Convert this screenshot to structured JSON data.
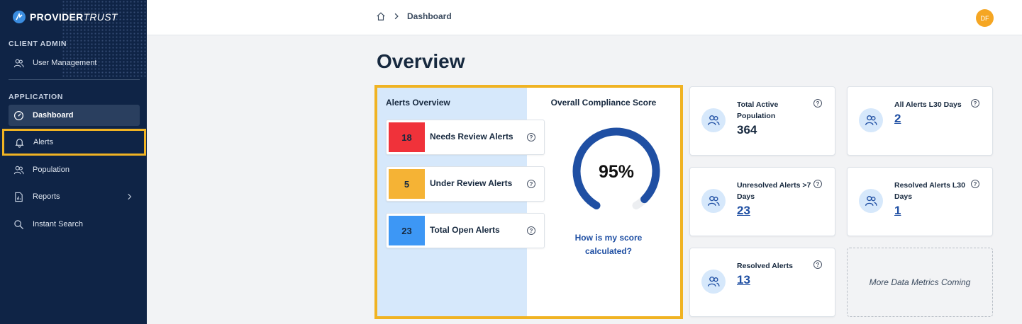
{
  "brand": {
    "name_bold": "PROVIDER",
    "name_light": "TRUST"
  },
  "sidebar": {
    "client_admin_label": "CLIENT ADMIN",
    "user_management": "User Management",
    "application_label": "APPLICATION",
    "items": [
      {
        "label": "Dashboard",
        "icon": "dashboard-icon"
      },
      {
        "label": "Alerts",
        "icon": "bell-icon"
      },
      {
        "label": "Population",
        "icon": "users-icon"
      },
      {
        "label": "Reports",
        "icon": "report-icon"
      },
      {
        "label": "Instant Search",
        "icon": "search-icon"
      }
    ]
  },
  "topbar": {
    "breadcrumb_current": "Dashboard",
    "avatar_initials": "DF"
  },
  "page": {
    "title": "Overview"
  },
  "alerts_overview": {
    "title": "Alerts Overview",
    "alerts": [
      {
        "count": "18",
        "label": "Needs Review Alerts",
        "color": "#f0323a"
      },
      {
        "count": "5",
        "label": "Under Review Alerts",
        "color": "#f5b335"
      },
      {
        "count": "23",
        "label": "Total Open Alerts",
        "color": "#3d97f5"
      }
    ]
  },
  "compliance": {
    "title": "Overall Compliance Score",
    "score_text": "95%",
    "score": 0.95,
    "link_line1": "How is my score",
    "link_line2": "calculated?"
  },
  "metrics": [
    {
      "label": "Total Active Population",
      "value": "364"
    },
    {
      "label": "All Alerts L30 Days",
      "value": "2"
    },
    {
      "label": "Unresolved Alerts >7 Days",
      "value": "23"
    },
    {
      "label": "Resolved Alerts L30 Days",
      "value": "1"
    },
    {
      "label": "Resolved Alerts",
      "value": "13"
    }
  ],
  "coming_soon": "More Data Metrics Coming",
  "help_glyph": "?",
  "colors": {
    "sidebar": "#0f2446",
    "highlight": "#f0b323",
    "gauge": "#1f4fa3",
    "link": "#1f4fa3"
  }
}
